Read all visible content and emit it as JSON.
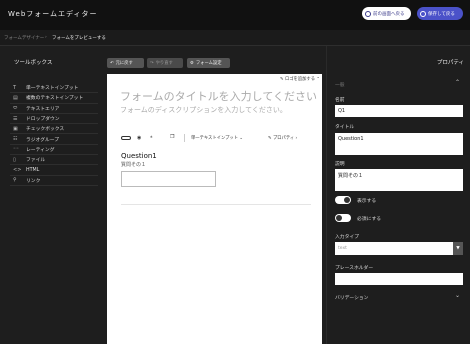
{
  "app": {
    "title": "Webフォームエディター"
  },
  "header": {
    "back_label": "前の画面へ戻る",
    "save_label": "保存して戻る"
  },
  "breadcrumb": {
    "parent": "フォームデザイナー",
    "separator": "›",
    "current": "フォームをプレビューする"
  },
  "toolbox": {
    "title": "ツールボックス",
    "items": [
      {
        "icon": "T",
        "label": "単一テキストインプット"
      },
      {
        "icon": "▤",
        "label": "複数のテキストインプット"
      },
      {
        "icon": "⬭",
        "label": "テキストエリア"
      },
      {
        "icon": "☰",
        "label": "ドロップダウン"
      },
      {
        "icon": "▣",
        "label": "チェックボックス"
      },
      {
        "icon": "☷",
        "label": "ラジオグループ"
      },
      {
        "icon": "◦◦",
        "label": "レーティング"
      },
      {
        "icon": "▯",
        "label": "ファイル"
      },
      {
        "icon": "<>",
        "label": "HTML"
      },
      {
        "icon": "⚲",
        "label": "リンク"
      }
    ]
  },
  "canvas_toolbar": {
    "undo_label": "元に戻す",
    "redo_label": "やり直す",
    "settings_label": "フォーム設定"
  },
  "form": {
    "logo_link": "ロゴを追加する",
    "title_placeholder": "フォームのタイトルを入力してください",
    "description_placeholder": "フォームのディスクリプションを入力してください。",
    "question_toolbar": {
      "type_label": "単一テキストインプット ⌄",
      "properties_label": "プロパティ ›"
    },
    "question": {
      "title": "Question1",
      "description": "質問その１"
    }
  },
  "properties": {
    "title": "プロパティ",
    "section_general": "一般",
    "name_label": "名前",
    "name_value": "Q1",
    "title_label": "タイトル",
    "title_value": "Question1",
    "description_label": "説明",
    "description_value": "質問その１",
    "visible_label": "表示する",
    "visible_on": true,
    "required_label": "必須にする",
    "required_on": false,
    "input_type_label": "入力タイプ",
    "input_type_value": "text",
    "placeholder_label": "プレースホルダー",
    "placeholder_value": "",
    "validation_label": "バリデーション"
  },
  "colors": {
    "accent": "#4b52c9",
    "panel": "#1e1e1e",
    "topbar": "#111111"
  }
}
